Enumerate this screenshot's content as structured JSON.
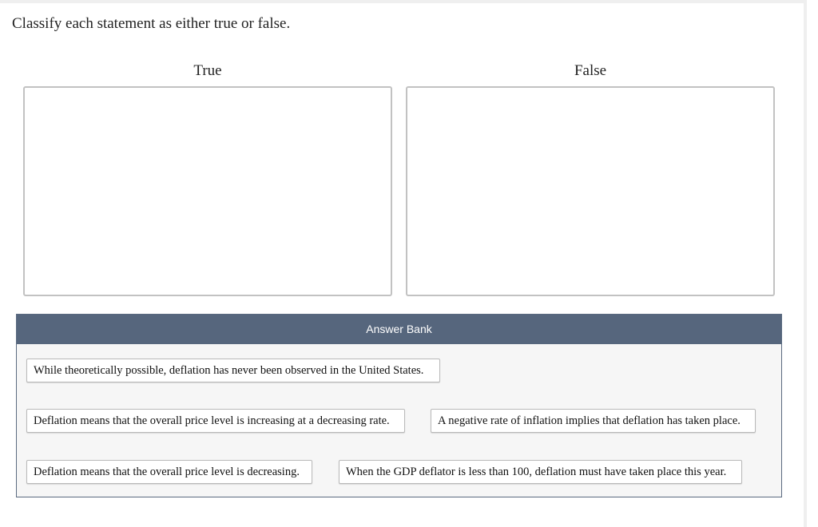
{
  "question": {
    "instructions": "Classify each statement as either true or false."
  },
  "bins": [
    {
      "title": "True"
    },
    {
      "title": "False"
    }
  ],
  "answer_bank": {
    "title": "Answer Bank",
    "items": [
      "While theoretically possible, deflation has never been observed in the United States.",
      "Deflation means that the overall price level is increasing at a decreasing rate.",
      "A negative rate of inflation implies that deflation has taken place.",
      "Deflation means that the overall price level is decreasing.",
      "When the GDP deflator is less than 100, deflation must have taken place this year."
    ]
  },
  "colors": {
    "bank_header_bg": "#56667d",
    "bank_bg": "#f6f6f6",
    "drop_zone_border": "#c2c2c2"
  }
}
